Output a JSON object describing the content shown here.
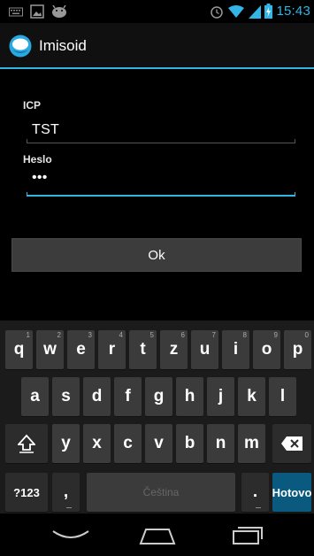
{
  "status_bar": {
    "time": "15:43",
    "left_icons": [
      "keyboard-icon",
      "image-icon",
      "android-icon"
    ],
    "right_icons": [
      "alarm-icon",
      "wifi-icon",
      "signal-icon",
      "battery-charging-icon"
    ],
    "accent": "#33b5e5"
  },
  "action_bar": {
    "title": "Imisoid",
    "logo_icon": "app-logo-icon",
    "accent": "#33b5e5"
  },
  "form": {
    "icp_label": "ICP",
    "icp_value": "TST",
    "password_label": "Heslo",
    "password_value": "•••",
    "ok_label": "Ok"
  },
  "keyboard": {
    "row1": [
      {
        "key": "q",
        "hint": "1"
      },
      {
        "key": "w",
        "hint": "2"
      },
      {
        "key": "e",
        "hint": "3"
      },
      {
        "key": "r",
        "hint": "4"
      },
      {
        "key": "t",
        "hint": "5"
      },
      {
        "key": "z",
        "hint": "6"
      },
      {
        "key": "u",
        "hint": "7"
      },
      {
        "key": "i",
        "hint": "8"
      },
      {
        "key": "o",
        "hint": "9"
      },
      {
        "key": "p",
        "hint": "0"
      }
    ],
    "row2": [
      "a",
      "s",
      "d",
      "f",
      "g",
      "h",
      "j",
      "k",
      "l"
    ],
    "row3": [
      "y",
      "x",
      "c",
      "v",
      "b",
      "n",
      "m"
    ],
    "symbols_label": "?123",
    "comma_label": ",",
    "space_label": "Čeština",
    "period_label": ".",
    "done_label": "Hotovo",
    "shift_icon": "shift-icon",
    "backspace_icon": "backspace-icon"
  },
  "nav_bar": {
    "icons": [
      "back-icon",
      "home-icon",
      "recent-apps-icon"
    ]
  }
}
